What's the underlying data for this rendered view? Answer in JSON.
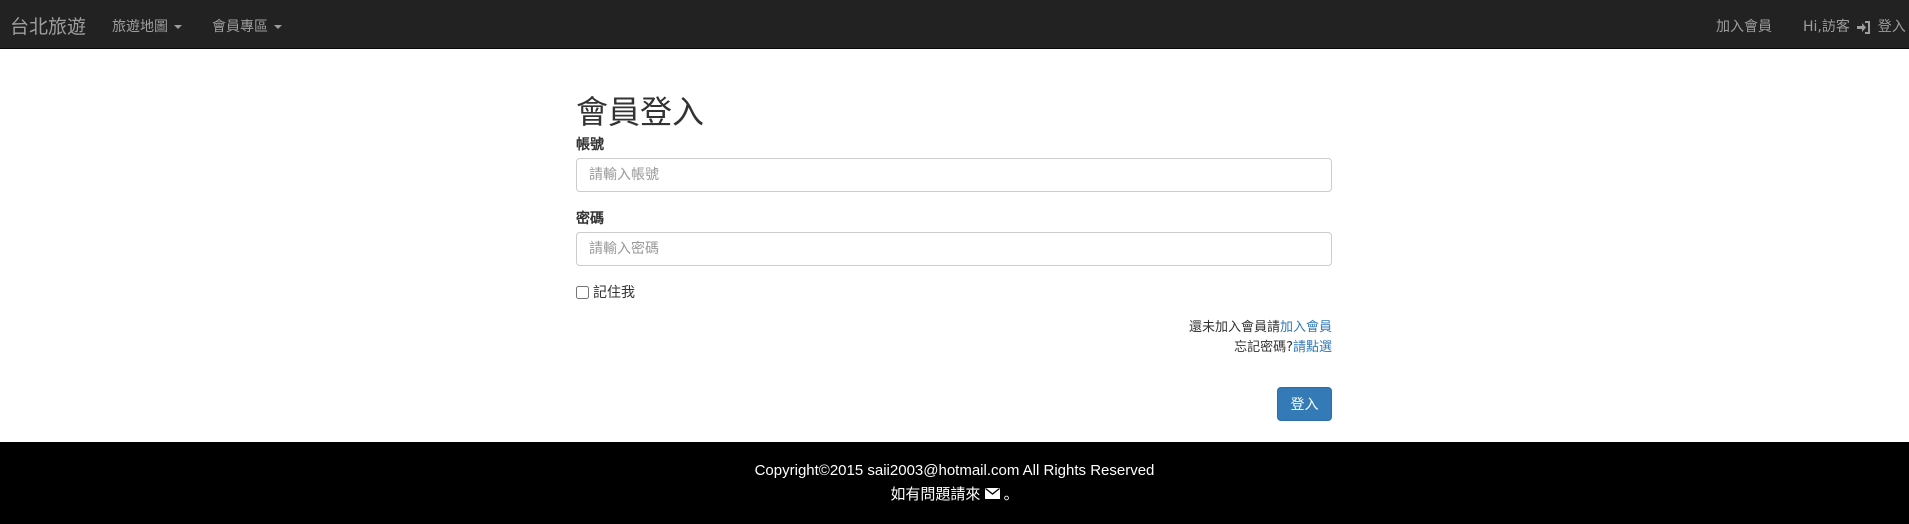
{
  "navbar": {
    "brand": "台北旅遊",
    "menu_map": "旅遊地圖",
    "menu_member": "會員專區",
    "join": "加入會員",
    "greeting": "Hi,訪客",
    "login": "登入"
  },
  "form": {
    "title": "會員登入",
    "account_label": "帳號",
    "account_placeholder": "請輸入帳號",
    "password_label": "密碼",
    "password_placeholder": "請輸入密碼",
    "remember_label": "記住我",
    "register_prompt": "還未加入會員請",
    "register_link": "加入會員",
    "forgot_prompt": "忘記密碼?",
    "forgot_link": "請點選",
    "submit": "登入"
  },
  "footer": {
    "copyright": "Copyright©2015 saii2003@hotmail.com All Rights Reserved",
    "contact_prefix": "如有問題請來",
    "contact_suffix": "。"
  }
}
